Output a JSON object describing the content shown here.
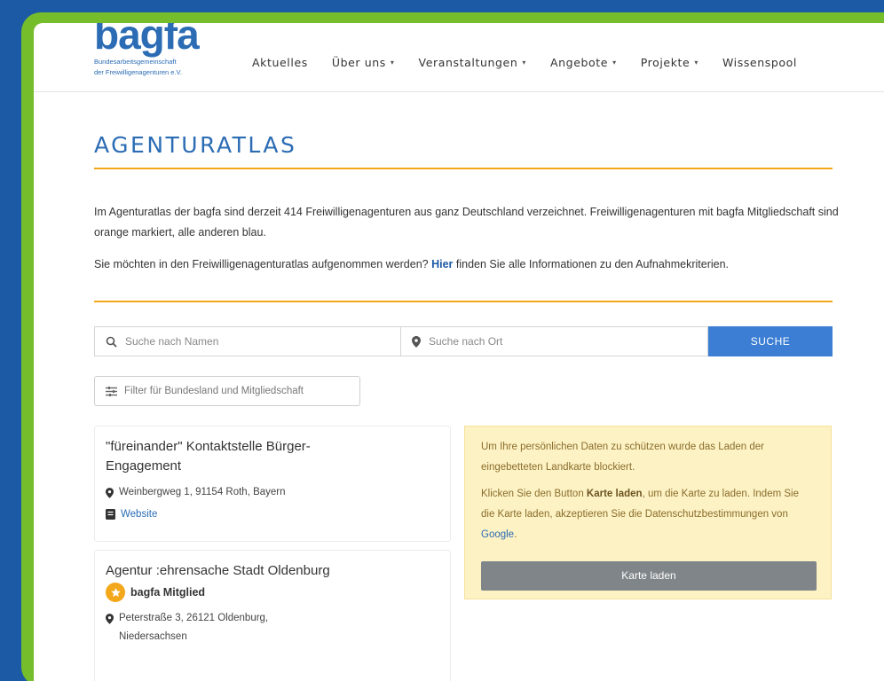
{
  "logo": {
    "word": "bagfa",
    "sub_line1": "Bundesarbeitsgemeinschaft",
    "sub_line2": "der Freiwilligenagenturen e.V."
  },
  "nav": {
    "items": [
      {
        "label": "Aktuelles",
        "caret": ""
      },
      {
        "label": "Über uns",
        "caret": "▾"
      },
      {
        "label": "Veranstaltungen",
        "caret": "▾"
      },
      {
        "label": "Angebote",
        "caret": "▾"
      },
      {
        "label": "Projekte",
        "caret": "▾"
      },
      {
        "label": "Wissenspool",
        "caret": ""
      }
    ]
  },
  "page": {
    "title": "AGENTURATLAS",
    "intro": "Im Agenturatlas der bagfa sind derzeit 414 Freiwilligenagenturen aus ganz Deutschland verzeichnet. Freiwilligenagenturen mit bagfa Mitgliedschaft sind orange markiert, alle anderen blau.",
    "join_before": "Sie möchten in den Freiwilligenagenturatlas aufgenommen werden? ",
    "join_link": "Hier",
    "join_after": " finden Sie alle Informationen zu den Aufnahmekriterien."
  },
  "search": {
    "name_placeholder": "Suche nach Namen",
    "place_placeholder": "Suche nach Ort",
    "button_label": "SUCHE",
    "filter_label": "Filter für Bundesland und Mitgliedschaft"
  },
  "results": [
    {
      "name": "\"füreinander\" Kontaktstelle Bürger-Engagement",
      "address": "Weinbergweg 1, 91154 Roth, Bayern",
      "website_label": "Website"
    },
    {
      "name": "Agentur :ehrensache Stadt Oldenburg",
      "member_label": "bagfa Mitglied",
      "address": "Peterstraße 3, 26121 Oldenburg, Niedersachsen"
    }
  ],
  "map_notice": {
    "text1": "Um Ihre persönlichen Daten zu schützen wurde das Laden der eingebetteten Landkarte blockiert.",
    "text2_before": "Klicken Sie den Button ",
    "text2_bold": "Karte laden",
    "text2_after": ", um die Karte zu laden. Indem Sie die Karte laden, akzeptieren Sie die Datenschutzbestimmungen von ",
    "text2_link": "Google",
    "text2_end": ".",
    "button_label": "Karte laden"
  },
  "colors": {
    "brand_blue": "#2b6cb4",
    "accent_orange": "#f3a81b",
    "frame_green": "#76bd2b",
    "background_blue": "#1d5aa6"
  }
}
